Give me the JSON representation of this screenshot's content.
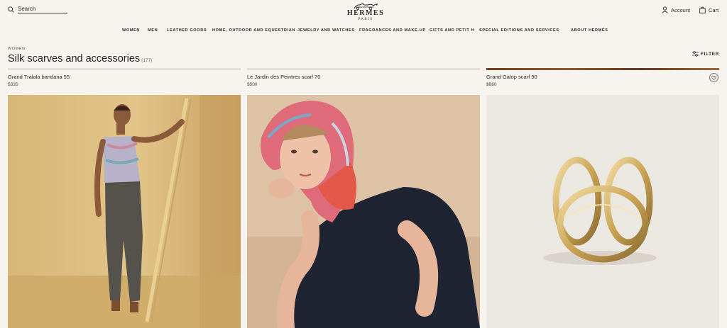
{
  "search": {
    "placeholder": "Search"
  },
  "logo": {
    "brand": "HERMES",
    "city": "PARIS"
  },
  "header": {
    "account_label": "Account",
    "cart_label": "Cart"
  },
  "nav": {
    "items": [
      "WOMEN",
      "MEN",
      "LEATHER GOODS",
      "HOME, OUTDOOR AND EQUESTRIAN",
      "JEWELRY AND WATCHES",
      "FRAGRANCES AND MAKE-UP",
      "GIFTS AND PETIT H",
      "SPECIAL EDITIONS AND SERVICES",
      "ABOUT HERMÈS"
    ]
  },
  "page": {
    "breadcrumb": "WOMEN",
    "title": "Silk scarves and accessories",
    "count": "(177)",
    "filter_label": "FILTER"
  },
  "products": [
    {
      "name": "Grand Tralala bandana 55",
      "price": "$335"
    },
    {
      "name": "Le Jardin des Peintres scarf 70",
      "price": "$500"
    },
    {
      "name": "Grand Galop scarf 90",
      "price": "$660"
    }
  ],
  "icons": {
    "search": "search-icon",
    "account": "user-icon",
    "cart": "shopping-bag-icon",
    "filter": "sliders-icon",
    "favorite": "heart-icon"
  },
  "colors": {
    "background": "#f7f3ee",
    "text": "#2a2a2a"
  }
}
